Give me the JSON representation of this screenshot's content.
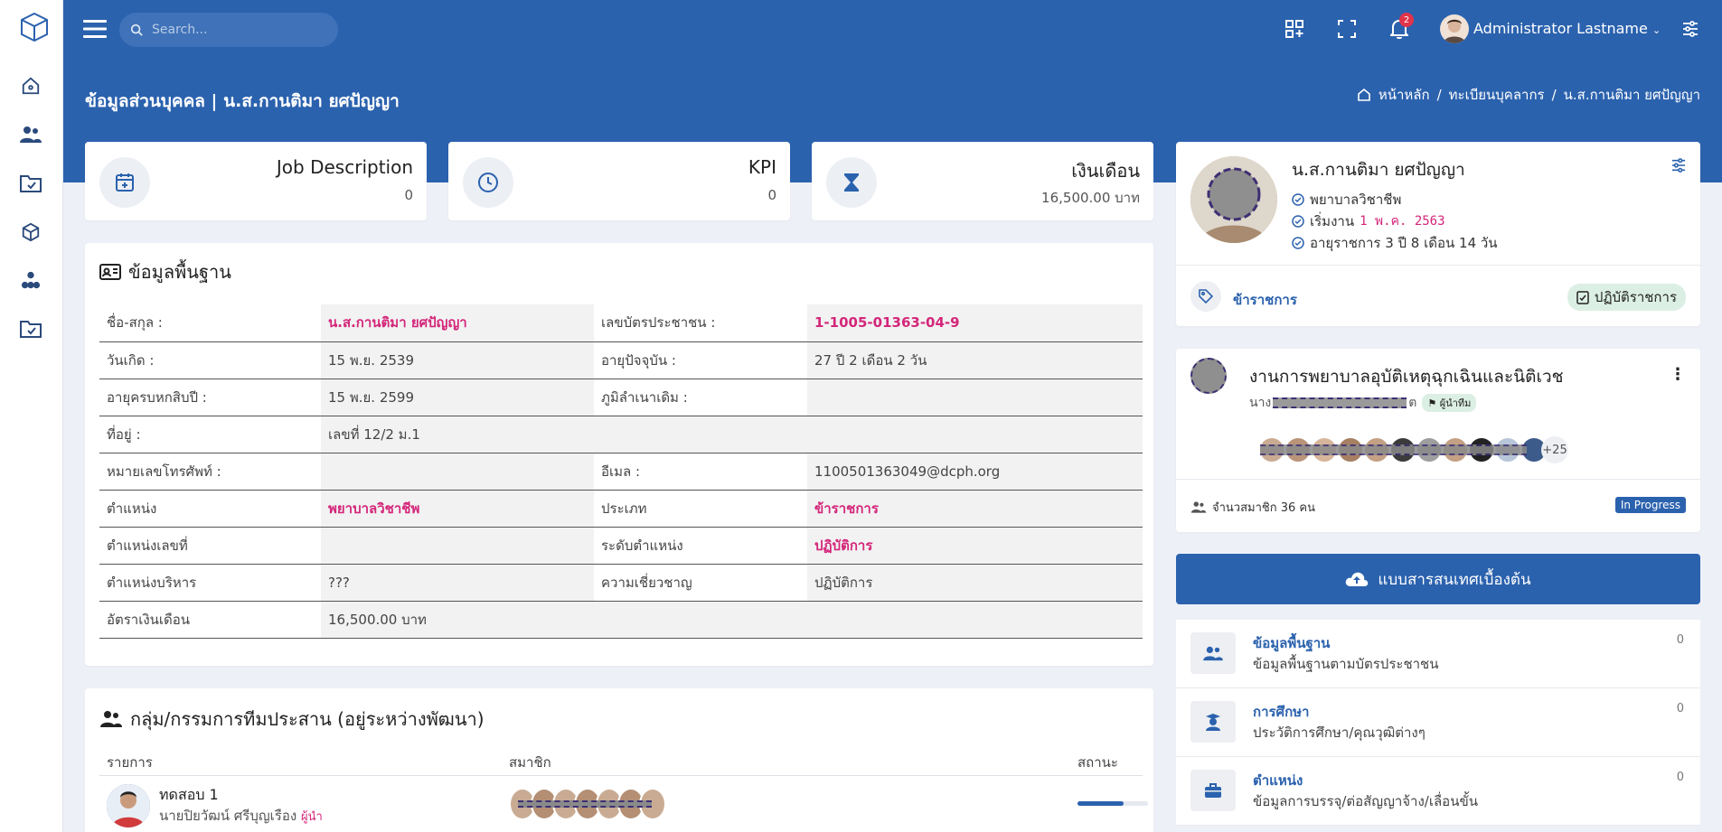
{
  "header": {
    "search_placeholder": "Search...",
    "notification_count": "2",
    "user_name": "Administrator Lastname",
    "page_title": "ข้อมูลส่วนบุคคล | น.ส.กานติมา ยศปัญญา",
    "breadcrumb": [
      "หน้าหลัก",
      "/",
      "ทะเบียนบุคลากร",
      "/",
      "น.ส.กานติมา ยศปัญญา"
    ]
  },
  "sidebar": {
    "items": [
      "home-icon",
      "users-icon",
      "folder-check-icon",
      "cube-icon",
      "org-chart-icon",
      "folder-check-icon"
    ]
  },
  "stats": [
    {
      "title": "Job Description",
      "value": "0",
      "icon": "calendar-plus-icon"
    },
    {
      "title": "KPI",
      "value": "0",
      "icon": "clock-icon"
    },
    {
      "title": "เงินเดือน",
      "value": "16,500.00 บาท",
      "icon": "hourglass-icon"
    }
  ],
  "basic_info": {
    "title": "ข้อมูลพื้นฐาน",
    "rows": [
      {
        "l1": "ชื่อ-สกุล :",
        "v1": "น.ส.กานติมา ยศปัญญา",
        "l2": "เลขบัตรประชาชน :",
        "v2": "1-1005-01363-04-9"
      },
      {
        "l1": "วันเกิด :",
        "v1": "15 พ.ย. 2539",
        "l2": "อายุปัจจุบัน :",
        "v2": "27 ปี 2 เดือน 2 วัน"
      },
      {
        "l1": "อายุครบหกสิบปี :",
        "v1": "15 พ.ย. 2599",
        "l2": "ภูมิลำเนาเดิม :",
        "v2": ""
      },
      {
        "l1": "ที่อยู่ :",
        "v1": "เลขที่ 12/2 ม.1",
        "l2": "",
        "v2": ""
      },
      {
        "l1": "หมายเลขโทรศัพท์ :",
        "v1": "",
        "l2": "อีเมล :",
        "v2": "1100501363049@dcph.org"
      },
      {
        "l1": "ตำแหน่ง",
        "v1": "พยาบาลวิชาชีพ",
        "l2": "ประเภท",
        "v2": "ข้าราชการ"
      },
      {
        "l1": "ตำแหน่งเลขที่",
        "v1": "",
        "l2": "ระดับตำแหน่ง",
        "v2": "ปฏิบัติการ"
      },
      {
        "l1": "ตำแหน่งบริหาร",
        "v1": "???",
        "l2": "ความเชี่ยวชาญ",
        "v2": "ปฏิบัติการ"
      },
      {
        "l1": "อัตราเงินเดือน",
        "v1": "16,500.00 บาท",
        "l2": "",
        "v2": ""
      }
    ]
  },
  "committee": {
    "title": "กลุ่ม/กรรมการทีมประสาน (อยู่ระหว่างพัฒนา)",
    "headers": [
      "รายการ",
      "สมาชิก",
      "สถานะ"
    ],
    "row": {
      "name": "ทดสอบ 1",
      "leader": "นายปิยวัฒน์ ศรีบุญเรือง",
      "leader_tag": "ผู้นำ",
      "progress_percent": 65
    }
  },
  "profile": {
    "name": "น.ส.กานติมา ยศปัญญา",
    "position": "พยาบาลวิชาชีพ",
    "start_label": "เริ่มงาน",
    "start_date": "1 พ.ค. 2563",
    "service": "อายุราชการ 3 ปี 8 เดือน 14 วัน",
    "type": "ข้าราชการ",
    "status_button": "ปฏิบัติราชการ"
  },
  "team": {
    "name": "งานการพยาบาลอุบัติเหตุฉุกเฉินและนิติเวช",
    "leader_prefix": "นาง",
    "leader_suffix": "ต",
    "leader_tag": "ผู้นำทีม",
    "more_members": "+25",
    "member_count": "จำนวสมาชิก 36 คน",
    "status": "In Progress"
  },
  "survey_button": "แบบสารสนเทศเบื้องต้น",
  "menu": [
    {
      "title": "ข้อมูลพื้นฐาน",
      "sub": "ข้อมูลพื้นฐานตามบัตรประชาชน",
      "count": "0",
      "icon": "user-group-icon"
    },
    {
      "title": "การศึกษา",
      "sub": "ประวัติการศึกษา/คุณวุฒิต่างๆ",
      "count": "0",
      "icon": "graduate-icon"
    },
    {
      "title": "ตำแหน่ง",
      "sub": "ข้อมูลการบรรจุ/ต่อสัญญาจ้าง/เลื่อนขั้น",
      "count": "0",
      "icon": "briefcase-icon"
    }
  ],
  "colors": {
    "primary": "#2b62ae",
    "pink": "#d4267a",
    "badge": "#e0344a",
    "success_bg": "#dcefe4"
  }
}
